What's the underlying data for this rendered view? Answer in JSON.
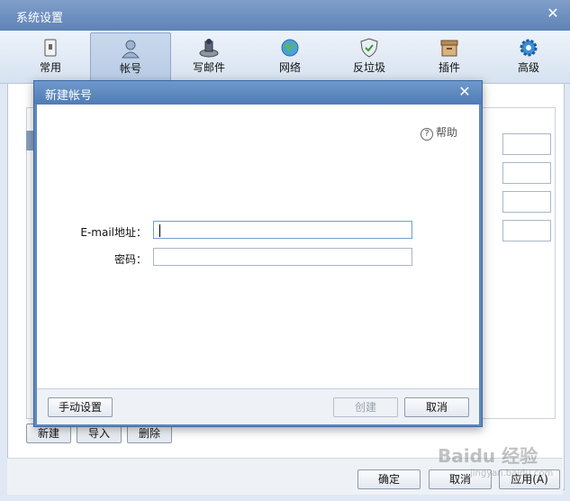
{
  "window": {
    "title": "系统设置"
  },
  "toolbar": {
    "items": [
      {
        "label": "常用",
        "icon": "general-settings-icon"
      },
      {
        "label": "帐号",
        "icon": "account-person-icon"
      },
      {
        "label": "写邮件",
        "icon": "compose-mail-icon"
      },
      {
        "label": "网络",
        "icon": "network-globe-icon"
      },
      {
        "label": "反垃圾",
        "icon": "anti-spam-shield-icon"
      },
      {
        "label": "插件",
        "icon": "plugin-box-icon"
      },
      {
        "label": "高级",
        "icon": "advanced-gear-icon"
      }
    ],
    "active_index": 1
  },
  "account_actions": {
    "new_label": "新建",
    "import_label": "导入",
    "delete_label": "删除"
  },
  "footer": {
    "ok_label": "确定",
    "cancel_label": "取消",
    "apply_label": "应用(A)"
  },
  "dialog": {
    "title": "新建帐号",
    "help_label": "帮助",
    "email_label": "E-mail地址：",
    "email_value": "",
    "password_label": "密码：",
    "password_value": "",
    "manual_setup_label": "手动设置",
    "create_label": "创建",
    "cancel_label": "取消"
  },
  "watermark": {
    "text": "Baidu 经验",
    "sub": "jingyan.baidu.com"
  },
  "colors": {
    "titlebar": "#5f83b7",
    "dialog_frame": "#5e88be",
    "accent_focus": "#6f9fd6"
  }
}
